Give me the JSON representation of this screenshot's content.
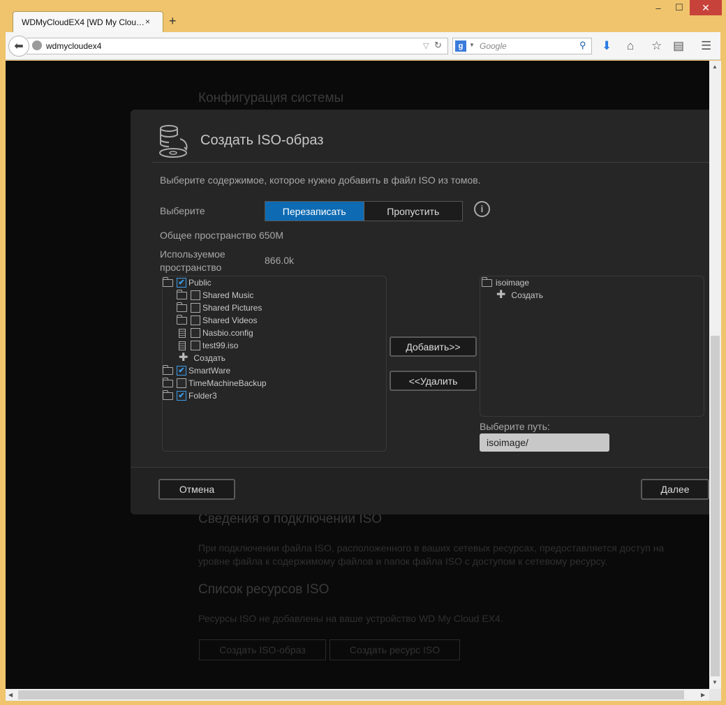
{
  "browser": {
    "tab_title": "WDMyCloudEX4 [WD My Clou…",
    "tab_close": "×",
    "new_tab": "+",
    "url": "wdmycloudex4",
    "search_placeholder": "Google",
    "search_engine_letter": "g",
    "controls": {
      "minimize": "‒",
      "maximize": "☐",
      "close": "✕"
    }
  },
  "background_page": {
    "heading_config": "Конфигурация системы",
    "heading_connection": "Сведения о подключении ISO",
    "connection_text": "При подключении файла ISO, расположенного в ваших сетевых ресурсах, предоставляется доступ на уровне файла к содержимому файлов и папок файла ISO с доступом к сетевому ресурсу.",
    "heading_list": "Список ресурсов ISO",
    "list_text": "Ресурсы ISO не добавлены на ваше устройство WD My Cloud EX4.",
    "btn_create_iso": "Создать ISO-образ",
    "btn_create_share": "Создать ресурс ISO"
  },
  "dialog": {
    "title": "Создать ISO-образ",
    "description": "Выберите содержимое, которое нужно добавить в файл ISO из томов.",
    "select_label": "Выберите",
    "overwrite_label": "Перезаписать",
    "skip_label": "Пропустить",
    "info_label": "i",
    "total_space_label": "Общее пространство 650M",
    "used_space_label_1": "Используемое",
    "used_space_label_2": "пространство",
    "used_space_value": "866.0k",
    "source_tree": [
      {
        "label": "Public",
        "type": "folder",
        "checked": true
      },
      {
        "label": "Shared Music",
        "type": "folder",
        "checked": false
      },
      {
        "label": "Shared Pictures",
        "type": "folder",
        "checked": false
      },
      {
        "label": "Shared Videos",
        "type": "folder",
        "checked": false
      },
      {
        "label": "Nasbio.config",
        "type": "file",
        "checked": false
      },
      {
        "label": "test99.iso",
        "type": "file",
        "checked": false
      },
      {
        "label": "Создать",
        "type": "create"
      },
      {
        "label": "SmartWare",
        "type": "folder",
        "checked": true
      },
      {
        "label": "TimeMachineBackup",
        "type": "folder",
        "checked": false
      },
      {
        "label": "Folder3",
        "type": "folder",
        "checked": true
      }
    ],
    "add_button": "Добавить>>",
    "remove_button": "<<Удалить",
    "target_tree": [
      {
        "label": "isoimage",
        "type": "folder"
      },
      {
        "label": "Создать",
        "type": "create"
      }
    ],
    "path_label": "Выберите путь:",
    "path_value": "isoimage/",
    "cancel_button": "Отмена",
    "next_button": "Далее",
    "check_mark": "✔",
    "plus_glyph": "✚"
  },
  "colors": {
    "accent": "#0e6bb3",
    "check": "#3a9be8",
    "frame": "#efc46c"
  }
}
